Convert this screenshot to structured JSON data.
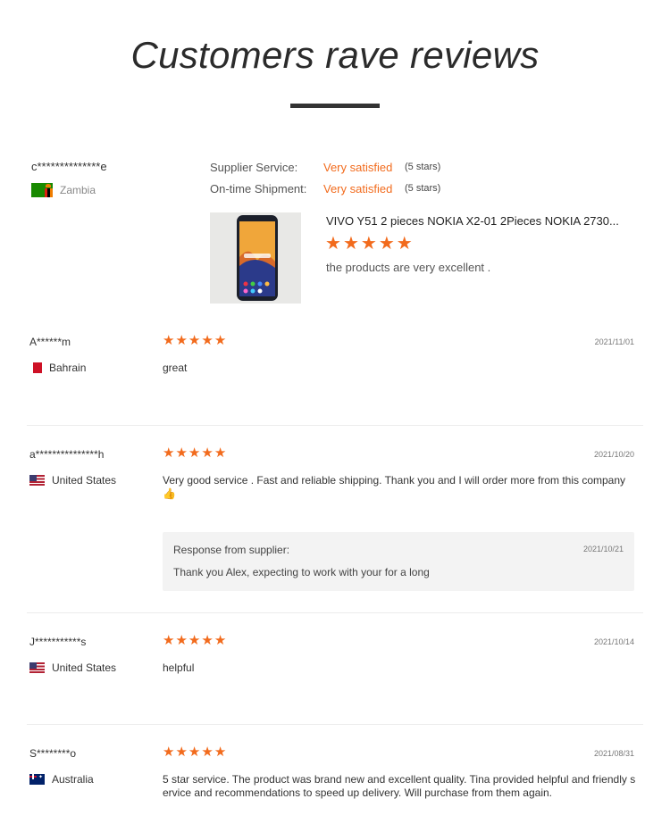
{
  "page": {
    "title": "Customers rave reviews"
  },
  "featured": {
    "reviewer": "c**************e",
    "country": "Zambia",
    "supplier_service_label": "Supplier Service:",
    "supplier_service_value": "Very satisfied",
    "supplier_service_stars": "(5 stars)",
    "shipment_label": "On-time Shipment:",
    "shipment_value": "Very satisfied",
    "shipment_stars": "(5 stars)",
    "product_title": "VIVO Y51 2 pieces NOKIA X2-01 2Pieces NOKIA 2730...",
    "rating": 5,
    "comment": "the products are very excellent ."
  },
  "reviews": [
    {
      "name": "A******m",
      "country": "Bahrain",
      "date": "2021/11/01",
      "rating": 5,
      "text": "great"
    },
    {
      "name": "a***************h",
      "country": "United States",
      "date": "2021/10/20",
      "rating": 5,
      "text": "Very good service . Fast and reliable shipping. Thank you and I will order more from this company 👍",
      "response": {
        "label": "Response from supplier:",
        "date": "2021/10/21",
        "text": "Thank you Alex, expecting to work with your for a long"
      }
    },
    {
      "name": "J***********s",
      "country": "United States",
      "date": "2021/10/14",
      "rating": 5,
      "text": "helpful"
    },
    {
      "name": "S********o",
      "country": "Australia",
      "date": "2021/08/31",
      "rating": 5,
      "text": "5 star service. The product was brand new and excellent quality. Tina provided helpful and friendly service and recommendations to speed up delivery. Will purchase from them again."
    }
  ],
  "colors": {
    "accent": "#f26b1d",
    "title": "#2b2b2b"
  },
  "icons": {
    "star": "star-icon"
  }
}
